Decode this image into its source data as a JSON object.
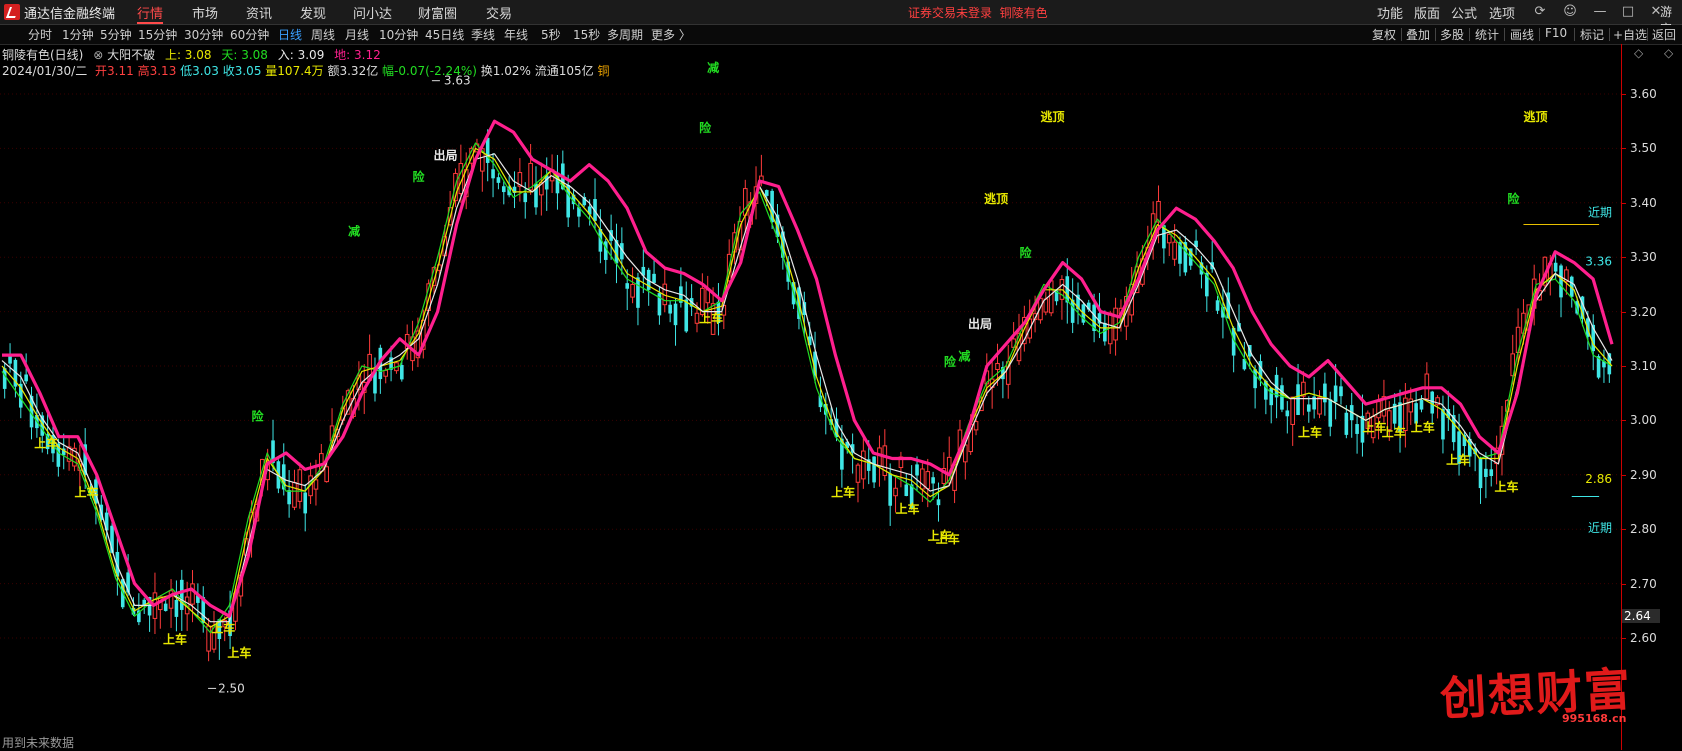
{
  "app": {
    "title": "通达信金融终端",
    "status_text": "证券交易未登录",
    "stock_title": "铜陵有色",
    "guest": "游客"
  },
  "menu": [
    "行情",
    "市场",
    "资讯",
    "发现",
    "问小达",
    "财富圈",
    "交易"
  ],
  "right_menu": [
    "功能",
    "版面",
    "公式",
    "选项"
  ],
  "right_icons": [
    "refresh-icon",
    "user-icon",
    "minimize-icon",
    "maximize-icon",
    "close-icon"
  ],
  "periods": [
    "分时",
    "1分钟",
    "5分钟",
    "15分钟",
    "30分钟",
    "60分钟",
    "日线",
    "周线",
    "月线",
    "10分钟",
    "45日线",
    "季线",
    "年线",
    "5秒",
    "15秒",
    "多周期",
    "更多 〉"
  ],
  "active_period": "日线",
  "tools": [
    "复权",
    "叠加",
    "多股",
    "统计",
    "画线",
    "F10",
    "标记",
    "+自选",
    "返回"
  ],
  "info": {
    "name": "铜陵有色(日线)",
    "indicator": "大阳不破",
    "shang": "上: 3.08",
    "tian": "天: 3.08",
    "ru": "入: 3.09",
    "di": "地: 3.12",
    "date": "2024/01/30/二",
    "open": "开3.11",
    "high": "高3.13",
    "low": "低3.03",
    "close": "收3.05",
    "volume": "量107.4万",
    "amount": "额3.32亿",
    "change": "幅-0.07(-2.24%)",
    "turnover": "换1.02%",
    "float_cap": "流通105亿",
    "sector": "铜"
  },
  "colors": {
    "up": "#ff3b3b",
    "down": "#3fe6e6",
    "ma_main": "#ff1f8e",
    "ma_white": "#e8e8e8",
    "ma_yellow": "#e8e800",
    "ma_green": "#22dd22",
    "signal_buy": "#e8e800",
    "signal_warn": "#22dd22",
    "axis_border": "#cc0000"
  },
  "chart_data": {
    "type": "candlestick",
    "ylim": [
      2.5,
      3.7
    ],
    "yticks": [
      "3.60",
      "3.50",
      "3.40",
      "3.30",
      "3.20",
      "3.10",
      "3.00",
      "2.90",
      "2.80",
      "2.70",
      "2.60"
    ],
    "current_price_label": "2.64",
    "high_mark": "3.63",
    "low_mark": "2.50",
    "right_labels": [
      {
        "text": "3.36",
        "y": 3.285
      },
      {
        "text": "2.86",
        "y": 2.885
      },
      {
        "text": "近期",
        "y": 3.375
      },
      {
        "text": "近期",
        "y": 2.795
      }
    ],
    "ma_main": [
      3.12,
      3.12,
      3.05,
      2.97,
      2.97,
      2.9,
      2.8,
      2.7,
      2.66,
      2.68,
      2.69,
      2.66,
      2.64,
      2.75,
      2.92,
      2.94,
      2.91,
      2.92,
      2.97,
      3.05,
      3.11,
      3.15,
      3.12,
      3.2,
      3.36,
      3.48,
      3.55,
      3.53,
      3.48,
      3.46,
      3.44,
      3.47,
      3.44,
      3.39,
      3.31,
      3.28,
      3.27,
      3.25,
      3.22,
      3.29,
      3.44,
      3.43,
      3.35,
      3.26,
      3.12,
      3.0,
      2.94,
      2.93,
      2.93,
      2.92,
      2.9,
      2.98,
      3.1,
      3.14,
      3.18,
      3.24,
      3.29,
      3.26,
      3.2,
      3.19,
      3.26,
      3.35,
      3.39,
      3.37,
      3.33,
      3.28,
      3.2,
      3.14,
      3.1,
      3.08,
      3.11,
      3.07,
      3.03,
      3.04,
      3.05,
      3.06,
      3.06,
      3.03,
      2.97,
      2.94,
      3.05,
      3.23,
      3.31,
      3.29,
      3.26,
      3.14
    ],
    "ma_white": [
      3.11,
      3.08,
      3.01,
      2.96,
      2.94,
      2.86,
      2.74,
      2.66,
      2.66,
      2.68,
      2.66,
      2.63,
      2.63,
      2.77,
      2.91,
      2.89,
      2.88,
      2.91,
      3.0,
      3.07,
      3.1,
      3.12,
      3.15,
      3.25,
      3.39,
      3.48,
      3.49,
      3.44,
      3.42,
      3.45,
      3.43,
      3.4,
      3.35,
      3.3,
      3.26,
      3.24,
      3.23,
      3.2,
      3.2,
      3.32,
      3.43,
      3.37,
      3.26,
      3.12,
      3.0,
      2.94,
      2.92,
      2.91,
      2.9,
      2.87,
      2.88,
      2.97,
      3.05,
      3.09,
      3.15,
      3.22,
      3.25,
      3.22,
      3.18,
      3.17,
      3.25,
      3.34,
      3.35,
      3.32,
      3.28,
      3.2,
      3.12,
      3.07,
      3.04,
      3.04,
      3.04,
      3.02,
      3.0,
      3.02,
      3.03,
      3.04,
      3.03,
      2.99,
      2.94,
      2.92,
      3.06,
      3.22,
      3.27,
      3.25,
      3.17,
      3.11
    ],
    "ma_yellow": [
      3.1,
      3.06,
      3.0,
      2.95,
      2.93,
      2.84,
      2.72,
      2.65,
      2.67,
      2.68,
      2.65,
      2.62,
      2.64,
      2.8,
      2.93,
      2.88,
      2.87,
      2.91,
      3.02,
      3.09,
      3.1,
      3.11,
      3.16,
      3.28,
      3.42,
      3.5,
      3.48,
      3.42,
      3.42,
      3.46,
      3.42,
      3.38,
      3.33,
      3.27,
      3.25,
      3.23,
      3.22,
      3.2,
      3.21,
      3.36,
      3.43,
      3.35,
      3.23,
      3.08,
      2.98,
      2.93,
      2.92,
      2.9,
      2.89,
      2.86,
      2.88,
      2.98,
      3.06,
      3.09,
      3.17,
      3.24,
      3.24,
      3.2,
      3.17,
      3.17,
      3.28,
      3.36,
      3.34,
      3.3,
      3.26,
      3.17,
      3.1,
      3.06,
      3.04,
      3.05,
      3.04,
      3.02,
      3.0,
      3.02,
      3.03,
      3.04,
      3.02,
      2.98,
      2.93,
      2.93,
      3.1,
      3.24,
      3.27,
      3.24,
      3.14,
      3.1
    ],
    "ma_green": [
      3.09,
      3.04,
      2.99,
      2.94,
      2.92,
      2.83,
      2.71,
      2.64,
      2.67,
      2.69,
      2.65,
      2.61,
      2.66,
      2.82,
      2.94,
      2.87,
      2.87,
      2.92,
      3.03,
      3.1,
      3.09,
      3.1,
      3.18,
      3.3,
      3.44,
      3.51,
      3.47,
      3.41,
      3.43,
      3.46,
      3.41,
      3.37,
      3.31,
      3.26,
      3.24,
      3.22,
      3.22,
      3.2,
      3.22,
      3.38,
      3.42,
      3.33,
      3.21,
      3.06,
      2.97,
      2.93,
      2.92,
      2.9,
      2.88,
      2.85,
      2.89,
      2.99,
      3.07,
      3.1,
      3.18,
      3.25,
      3.23,
      3.19,
      3.16,
      3.18,
      3.3,
      3.37,
      3.33,
      3.29,
      3.25,
      3.15,
      3.09,
      3.05,
      3.04,
      3.05,
      3.04,
      3.02,
      3.0,
      3.02,
      3.03,
      3.04,
      3.02,
      2.98,
      2.93,
      2.94,
      3.12,
      3.25,
      3.26,
      3.22,
      3.12,
      3.1
    ],
    "signals": [
      {
        "text": "上车",
        "x": 0.02,
        "y": 2.95,
        "kind": "buy"
      },
      {
        "text": "上车",
        "x": 0.045,
        "y": 2.86,
        "kind": "buy"
      },
      {
        "text": "上车",
        "x": 0.1,
        "y": 2.59,
        "kind": "buy"
      },
      {
        "text": "上车",
        "x": 0.13,
        "y": 2.61,
        "kind": "buy"
      },
      {
        "text": "上车",
        "x": 0.14,
        "y": 2.565,
        "kind": "buy"
      },
      {
        "text": "险",
        "x": 0.155,
        "y": 3.0,
        "kind": "warn"
      },
      {
        "text": "减",
        "x": 0.215,
        "y": 3.34,
        "kind": "warn"
      },
      {
        "text": "险",
        "x": 0.255,
        "y": 3.44,
        "kind": "warn"
      },
      {
        "text": "出局",
        "x": 0.268,
        "y": 3.48,
        "kind": "exit"
      },
      {
        "text": "减",
        "x": 0.438,
        "y": 3.64,
        "kind": "warn"
      },
      {
        "text": "险",
        "x": 0.433,
        "y": 3.53,
        "kind": "warn"
      },
      {
        "text": "上车",
        "x": 0.433,
        "y": 3.18,
        "kind": "buy"
      },
      {
        "text": "上车",
        "x": 0.515,
        "y": 2.86,
        "kind": "buy"
      },
      {
        "text": "上车",
        "x": 0.555,
        "y": 2.83,
        "kind": "buy"
      },
      {
        "text": "上车",
        "x": 0.575,
        "y": 2.78,
        "kind": "buy"
      },
      {
        "text": "上车",
        "x": 0.58,
        "y": 2.775,
        "kind": "buy"
      },
      {
        "text": "险",
        "x": 0.585,
        "y": 3.1,
        "kind": "warn"
      },
      {
        "text": "减",
        "x": 0.594,
        "y": 3.11,
        "kind": "warn"
      },
      {
        "text": "出局",
        "x": 0.6,
        "y": 3.17,
        "kind": "exit"
      },
      {
        "text": "逃顶",
        "x": 0.61,
        "y": 3.4,
        "kind": "top"
      },
      {
        "text": "险",
        "x": 0.632,
        "y": 3.3,
        "kind": "warn"
      },
      {
        "text": "逃顶",
        "x": 0.645,
        "y": 3.55,
        "kind": "top"
      },
      {
        "text": "上车",
        "x": 0.805,
        "y": 2.97,
        "kind": "buy"
      },
      {
        "text": "上车",
        "x": 0.845,
        "y": 2.98,
        "kind": "buy"
      },
      {
        "text": "上车",
        "x": 0.857,
        "y": 2.97,
        "kind": "buy"
      },
      {
        "text": "上车",
        "x": 0.875,
        "y": 2.98,
        "kind": "buy"
      },
      {
        "text": "上车",
        "x": 0.897,
        "y": 2.92,
        "kind": "buy"
      },
      {
        "text": "上车",
        "x": 0.927,
        "y": 2.87,
        "kind": "buy"
      },
      {
        "text": "险",
        "x": 0.935,
        "y": 3.4,
        "kind": "warn"
      },
      {
        "text": "逃顶",
        "x": 0.945,
        "y": 3.55,
        "kind": "top"
      }
    ],
    "hlines": [
      {
        "y": 3.36,
        "x0": 0.945,
        "x1": 0.992
      },
      {
        "y": 2.86,
        "x0": 0.975,
        "x1": 0.992
      }
    ]
  },
  "watermark": {
    "main": "创想财富",
    "sub": "995168.cn"
  },
  "footnote": "用到未来数据"
}
